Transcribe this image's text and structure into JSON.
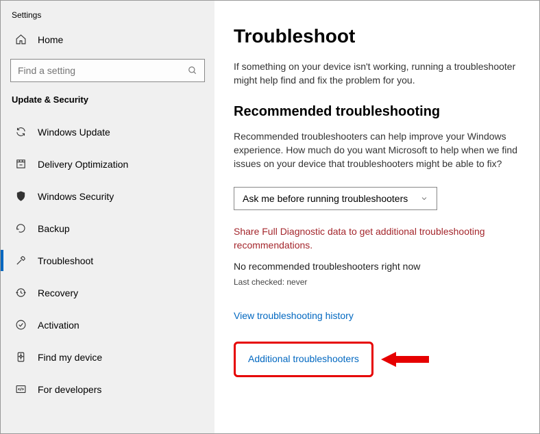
{
  "window": {
    "title": "Settings"
  },
  "sidebar": {
    "home_label": "Home",
    "search_placeholder": "Find a setting",
    "section_header": "Update & Security",
    "items": [
      {
        "label": "Windows Update"
      },
      {
        "label": "Delivery Optimization"
      },
      {
        "label": "Windows Security"
      },
      {
        "label": "Backup"
      },
      {
        "label": "Troubleshoot"
      },
      {
        "label": "Recovery"
      },
      {
        "label": "Activation"
      },
      {
        "label": "Find my device"
      },
      {
        "label": "For developers"
      }
    ]
  },
  "main": {
    "heading": "Troubleshoot",
    "intro": "If something on your device isn't working, running a troubleshooter might help find and fix the problem for you.",
    "rec_heading": "Recommended troubleshooting",
    "rec_text": "Recommended troubleshooters can help improve your Windows experience. How much do you want Microsoft to help when we find issues on your device that troubleshooters might be able to fix?",
    "dropdown_value": "Ask me before running troubleshooters",
    "warning": "Share Full Diagnostic data to get additional troubleshooting recommendations.",
    "status": "No recommended troubleshooters right now",
    "last_checked": "Last checked: never",
    "history_link": "View troubleshooting history",
    "additional_link": "Additional troubleshooters"
  }
}
